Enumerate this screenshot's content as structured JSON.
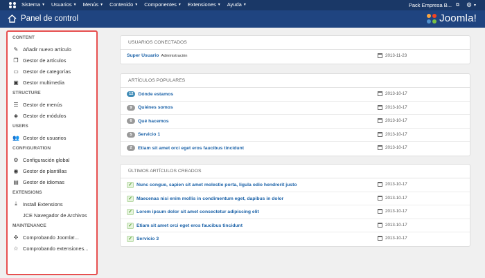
{
  "navbar": {
    "menu": [
      "Sistema",
      "Usuarios",
      "Menús",
      "Contenido",
      "Componentes",
      "Extensiones",
      "Ayuda"
    ],
    "site_name": "Pack Empresa B..."
  },
  "header": {
    "title": "Panel de control",
    "brand": "Joomla!"
  },
  "sidebar": {
    "groups": [
      {
        "heading": "CONTENT",
        "items": [
          "Añadir nuevo artículo",
          "Gestor de artículos",
          "Gestor de categorías",
          "Gestor multimedia"
        ]
      },
      {
        "heading": "STRUCTURE",
        "items": [
          "Gestor de menús",
          "Gestor de módulos"
        ]
      },
      {
        "heading": "USERS",
        "items": [
          "Gestor de usuarios"
        ]
      },
      {
        "heading": "CONFIGURATION",
        "items": [
          "Configuración global",
          "Gestor de plantillas",
          "Gestor de idiomas"
        ]
      },
      {
        "heading": "EXTENSIONS",
        "items": [
          "Install Extensions",
          "JCE Navegador de Archivos"
        ]
      },
      {
        "heading": "MAINTENANCE",
        "items": [
          "Comprobando Joomla!...",
          "Comprobando extensiones..."
        ]
      }
    ]
  },
  "logged_users": {
    "title": "USUARIOS CONECTADOS",
    "rows": [
      {
        "name": "Super Usuario",
        "role": "Administración",
        "date": "2013-11-23"
      }
    ]
  },
  "popular": {
    "title": "ARTÍCULOS POPULARES",
    "rows": [
      {
        "hits": "12",
        "title": "Dónde estamos",
        "date": "2013-10-17"
      },
      {
        "hits": "9",
        "title": "Quiénes somos",
        "date": "2013-10-17"
      },
      {
        "hits": "6",
        "title": "Qué hacemos",
        "date": "2013-10-17"
      },
      {
        "hits": "5",
        "title": "Servicio 1",
        "date": "2013-10-17"
      },
      {
        "hits": "2",
        "title": "Etiam sit amet orci eget eros faucibus tincidunt",
        "date": "2013-10-17"
      }
    ]
  },
  "latest": {
    "title": "ÚLTIMOS ARTÍCULOS CREADOS",
    "rows": [
      {
        "title": "Nunc congue, sapien sit amet molestie porta, ligula odio hendrerit justo",
        "date": "2013-10-17"
      },
      {
        "title": "Maecenas nisi enim mollis in condimentum eget, dapibus in dolor",
        "date": "2013-10-17"
      },
      {
        "title": "Lorem ipsum dolor sit amet consectetur adipiscing elit",
        "date": "2013-10-17"
      },
      {
        "title": "Etiam sit amet orci eget eros faucibus tincidunt",
        "date": "2013-10-17"
      },
      {
        "title": "Servicio 3",
        "date": "2013-10-17"
      }
    ]
  }
}
